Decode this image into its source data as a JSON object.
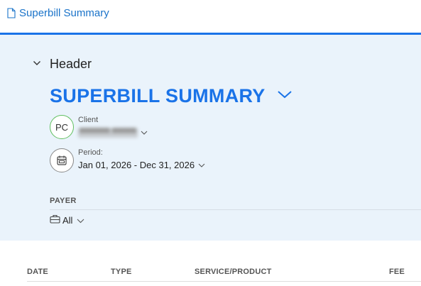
{
  "breadcrumb": {
    "icon": "document-icon",
    "label": "Superbill Summary"
  },
  "colors": {
    "accent": "#1a73e8",
    "panel_bg": "#eaf3fb",
    "avatar_border": "#5fbf5f"
  },
  "header_section": {
    "toggle_icon": "chevron-down-icon",
    "title": "Header",
    "document_title": "SUPERBILL SUMMARY",
    "client": {
      "avatar_initials": "PC",
      "label": "Client",
      "value": "▀▀▀▀▀ ▀▀▀▀"
    },
    "period": {
      "icon": "calendar-icon",
      "label": "Period:",
      "value": "Jan 01, 2026 - Dec 31, 2026"
    },
    "payer": {
      "label": "PAYER",
      "icon": "briefcase-icon",
      "value": "All"
    }
  },
  "table": {
    "columns": [
      "DATE",
      "TYPE",
      "SERVICE/PRODUCT",
      "FEE"
    ]
  }
}
